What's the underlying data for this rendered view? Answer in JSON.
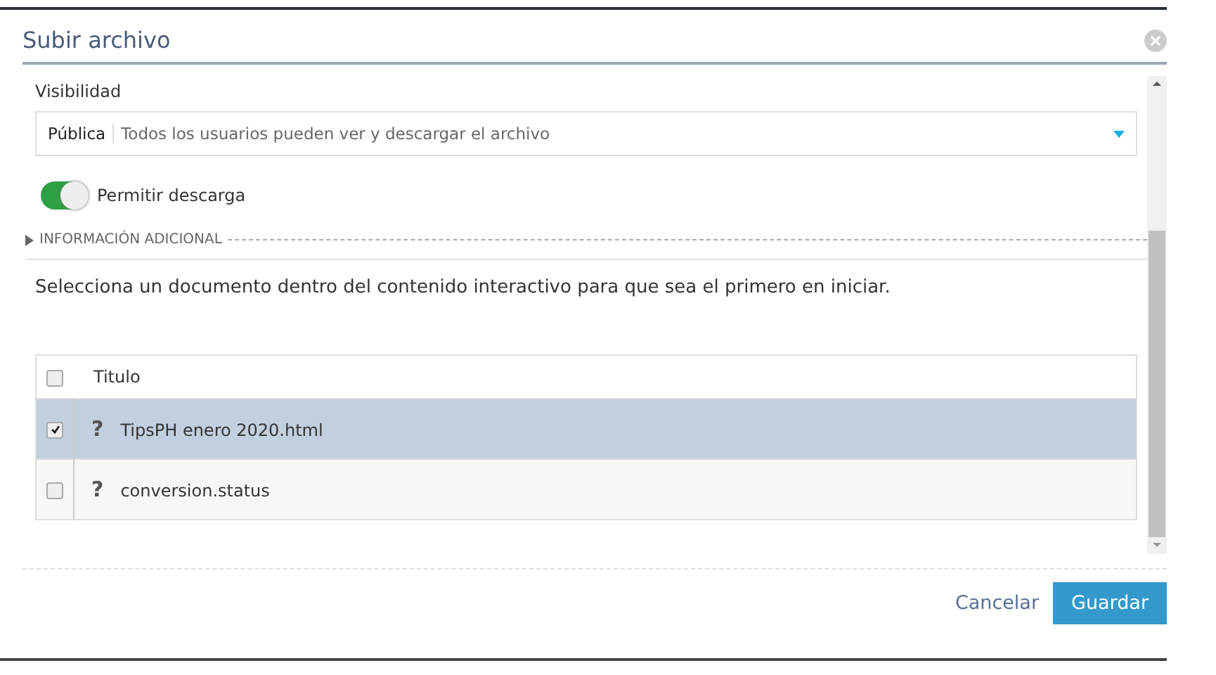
{
  "dialog": {
    "title": "Subir archivo"
  },
  "visibility": {
    "label": "Visibilidad",
    "value": "Pública",
    "description": "Todos los usuarios pueden ver y descargar el archivo"
  },
  "allow_download": {
    "label": "Permitir descarga",
    "on": true
  },
  "additional_info": {
    "label": "INFORMACIÓN ADICIONAL",
    "expanded": false
  },
  "instruction": "Selecciona un documento dentro del contenido interactivo para que sea el primero en iniciar.",
  "table": {
    "columns": [
      "Titulo"
    ],
    "header_checked": false,
    "rows": [
      {
        "icon": "?",
        "title": "TipsPH enero 2020.html",
        "checked": true,
        "selected": true
      },
      {
        "icon": "?",
        "title": "conversion.status",
        "checked": false,
        "selected": false
      }
    ]
  },
  "buttons": {
    "cancel": "Cancelar",
    "save": "Guardar"
  }
}
